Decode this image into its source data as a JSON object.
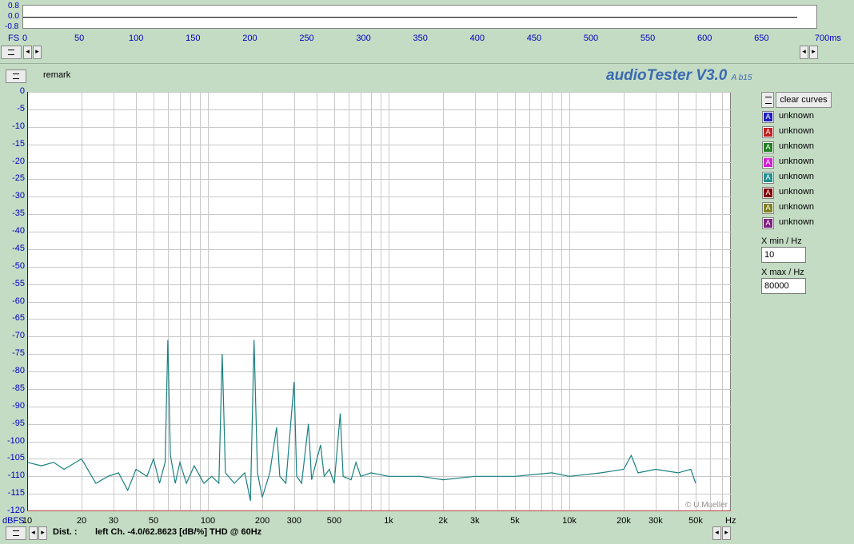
{
  "time_panel": {
    "y_labels": [
      "0.8",
      "0.0",
      "-0.8"
    ],
    "fs_label": "FS",
    "ticks": [
      "0",
      "50",
      "100",
      "150",
      "200",
      "250",
      "300",
      "350",
      "400",
      "450",
      "500",
      "550",
      "600",
      "650",
      "700ms"
    ]
  },
  "header": {
    "remark": "remark",
    "brand": "audioTester V3.0",
    "brand_ver": "A b15"
  },
  "legend": {
    "clear_label": "clear curves",
    "items": [
      {
        "label": "unknown",
        "color": "#2020c0"
      },
      {
        "label": "unknown",
        "color": "#c02020"
      },
      {
        "label": "unknown",
        "color": "#208020"
      },
      {
        "label": "unknown",
        "color": "#d020d0"
      },
      {
        "label": "unknown",
        "color": "#209090"
      },
      {
        "label": "unknown",
        "color": "#800000"
      },
      {
        "label": "unknown",
        "color": "#808020"
      },
      {
        "label": "unknown",
        "color": "#802080"
      }
    ],
    "swatch_glyph": "A"
  },
  "range": {
    "xmin_label": "X min / Hz",
    "xmin_value": "10",
    "xmax_label": "X max / Hz",
    "xmax_value": "80000"
  },
  "chart_data": {
    "type": "line",
    "x_scale": "log",
    "xlim": [
      10,
      80000
    ],
    "ylim": [
      -120,
      0
    ],
    "y_ticks": [
      "0",
      "-5",
      "-10",
      "-15",
      "-20",
      "-25",
      "-30",
      "-35",
      "-40",
      "-45",
      "-50",
      "-55",
      "-60",
      "-65",
      "-70",
      "-75",
      "-80",
      "-85",
      "-90",
      "-95",
      "-100",
      "-105",
      "-110",
      "-115",
      "-120"
    ],
    "x_ticks": [
      "10",
      "20",
      "30",
      "50",
      "100",
      "200",
      "300",
      "500",
      "1k",
      "2k",
      "3k",
      "5k",
      "10k",
      "20k",
      "30k",
      "50k"
    ],
    "ylabel": "dBFS",
    "xlabel": "Hz",
    "watermark": "© U.Mueller",
    "grid": true,
    "series": [
      {
        "color": "#1a8080",
        "points": [
          [
            10,
            -106
          ],
          [
            12,
            -107
          ],
          [
            14,
            -106
          ],
          [
            16,
            -108
          ],
          [
            20,
            -105
          ],
          [
            24,
            -112
          ],
          [
            28,
            -110
          ],
          [
            32,
            -109
          ],
          [
            36,
            -114
          ],
          [
            40,
            -108
          ],
          [
            46,
            -110
          ],
          [
            50,
            -105
          ],
          [
            54,
            -112
          ],
          [
            58,
            -106
          ],
          [
            60,
            -71
          ],
          [
            62,
            -104
          ],
          [
            66,
            -112
          ],
          [
            70,
            -106
          ],
          [
            76,
            -112
          ],
          [
            84,
            -107
          ],
          [
            95,
            -112
          ],
          [
            105,
            -110
          ],
          [
            115,
            -112
          ],
          [
            120,
            -75
          ],
          [
            125,
            -109
          ],
          [
            140,
            -112
          ],
          [
            160,
            -109
          ],
          [
            172,
            -117
          ],
          [
            180,
            -71
          ],
          [
            188,
            -109
          ],
          [
            200,
            -116
          ],
          [
            220,
            -109
          ],
          [
            240,
            -96
          ],
          [
            250,
            -110
          ],
          [
            270,
            -112
          ],
          [
            300,
            -83
          ],
          [
            310,
            -110
          ],
          [
            330,
            -112
          ],
          [
            360,
            -95
          ],
          [
            375,
            -111
          ],
          [
            420,
            -101
          ],
          [
            440,
            -110
          ],
          [
            470,
            -108
          ],
          [
            500,
            -112
          ],
          [
            540,
            -92
          ],
          [
            560,
            -110
          ],
          [
            620,
            -111
          ],
          [
            660,
            -106
          ],
          [
            700,
            -110
          ],
          [
            800,
            -109
          ],
          [
            1000,
            -110
          ],
          [
            1500,
            -110
          ],
          [
            2000,
            -111
          ],
          [
            3000,
            -110
          ],
          [
            5000,
            -110
          ],
          [
            8000,
            -109
          ],
          [
            10000,
            -110
          ],
          [
            15000,
            -109
          ],
          [
            20000,
            -108
          ],
          [
            22000,
            -104
          ],
          [
            24000,
            -109
          ],
          [
            30000,
            -108
          ],
          [
            40000,
            -109
          ],
          [
            47000,
            -108
          ],
          [
            50000,
            -112
          ]
        ]
      }
    ]
  },
  "footer": {
    "dist_label": "Dist. :",
    "status": "left Ch. -4.0/62.8623 [dB/%] THD @ 60Hz"
  }
}
